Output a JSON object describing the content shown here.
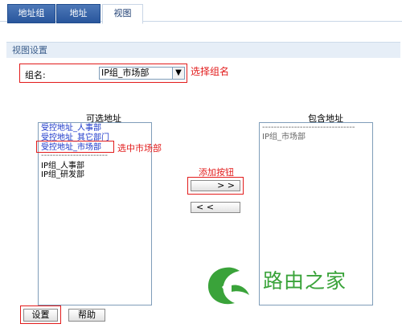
{
  "tabs": [
    {
      "label": "地址组"
    },
    {
      "label": "地址"
    },
    {
      "label": "视图"
    }
  ],
  "section": {
    "title": "视图设置"
  },
  "group": {
    "label": "组名:",
    "selected": "IP组_市场部",
    "annotation": "选择组名"
  },
  "available": {
    "title": "可选地址",
    "items": [
      {
        "text": "受控地址_人事部"
      },
      {
        "text": "受控地址_其它部门"
      },
      {
        "text": "受控地址_市场部"
      },
      {
        "text": "-----------------------"
      },
      {
        "text": "IP组_人事部"
      },
      {
        "text": "IP组_研发部"
      }
    ],
    "annotation": "选中市场部"
  },
  "included": {
    "title": "包含地址",
    "items": [
      {
        "text": "--------------------------------"
      },
      {
        "text": "IP组_市场部"
      }
    ]
  },
  "buttons": {
    "add_annotation": "添加按钮",
    "add_label": "> >",
    "remove_label": "< <",
    "settings_label": "设置",
    "help_label": "帮助"
  },
  "watermark": {
    "text": "路由之家"
  },
  "colors": {
    "tab_active_bg": "#2b5aa0",
    "section_header_bg": "#e6eef7",
    "annotation_red": "#e21b1b",
    "list_blue": "#1a36c9",
    "watermark_green": "#3aa33a"
  }
}
